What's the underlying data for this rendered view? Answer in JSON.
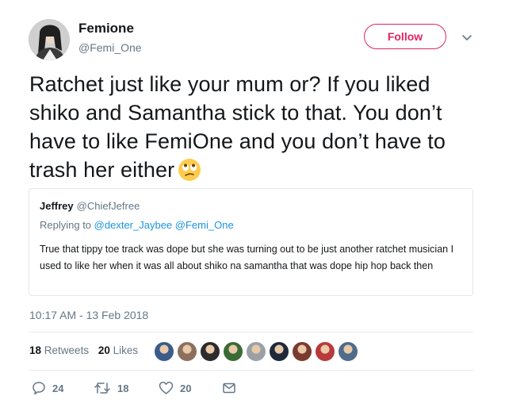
{
  "author": {
    "name": "Femione",
    "handle": "@Femi_One"
  },
  "follow_label": "Follow",
  "tweet": {
    "text": "Ratchet just like your mum or? If you liked shiko and Samantha stick to that. You don’t have to like FemiOne and you don’t have to trash her either",
    "emoji": "eye-roll-emoji"
  },
  "quoted": {
    "author_name": "Jeffrey",
    "author_handle": "@ChiefJefree",
    "replying_label": "Replying to",
    "replying_to_1": "@dexter_Jaybee",
    "replying_to_2": "@Femi_One",
    "text": "True that tippy toe track was dope but she was turning out to be just another ratchet musician I used to like her when it was all about shiko na samantha that was dope hip hop back then"
  },
  "timestamp": "10:17 AM - 13 Feb 2018",
  "stats": {
    "retweets_count": "18",
    "retweets_label": "Retweets",
    "likes_count": "20",
    "likes_label": "Likes"
  },
  "liker_colors": [
    "#3b5b8a",
    "#8d6f5e",
    "#2c2c2c",
    "#3a6b35",
    "#9aa0a6",
    "#1e2a3a",
    "#7a3b2e",
    "#b83a3a",
    "#4f6d8a"
  ],
  "actions": {
    "reply_count": "24",
    "retweet_count": "18",
    "like_count": "20"
  },
  "colors": {
    "accent_pink": "#e0245e",
    "link_blue": "#1b95e0",
    "muted": "#657786"
  }
}
